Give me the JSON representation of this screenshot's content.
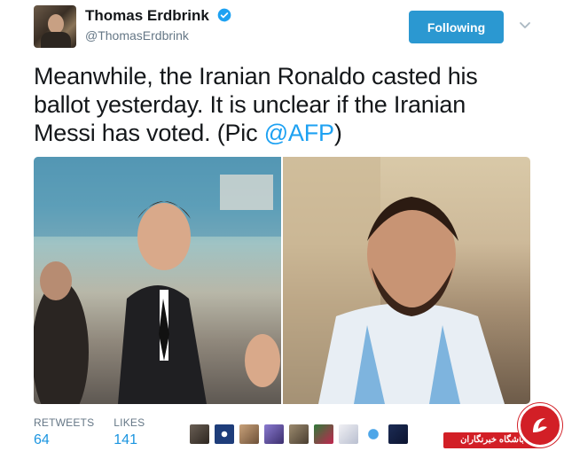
{
  "author": {
    "name": "Thomas Erdbrink",
    "handle": "@ThomasErdbrink",
    "verified": true
  },
  "follow_button": {
    "label": "Following"
  },
  "tweet": {
    "text_before": "Meanwhile, the Iranian Ronaldo casted his ballot yesterday. It is unclear if the Iranian Messi has voted. (Pic ",
    "mention": "@AFP",
    "text_after": ")"
  },
  "stats": {
    "retweets_label": "RETWEETS",
    "retweets_value": "64",
    "likes_label": "LIKES",
    "likes_value": "141"
  },
  "watermark": {
    "text": "باشگاه خبرنگاران"
  },
  "colors": {
    "follow_button": "#2b98d1",
    "link": "#1da1f2",
    "stat_value": "#1b95e0",
    "watermark": "#d21f26"
  }
}
